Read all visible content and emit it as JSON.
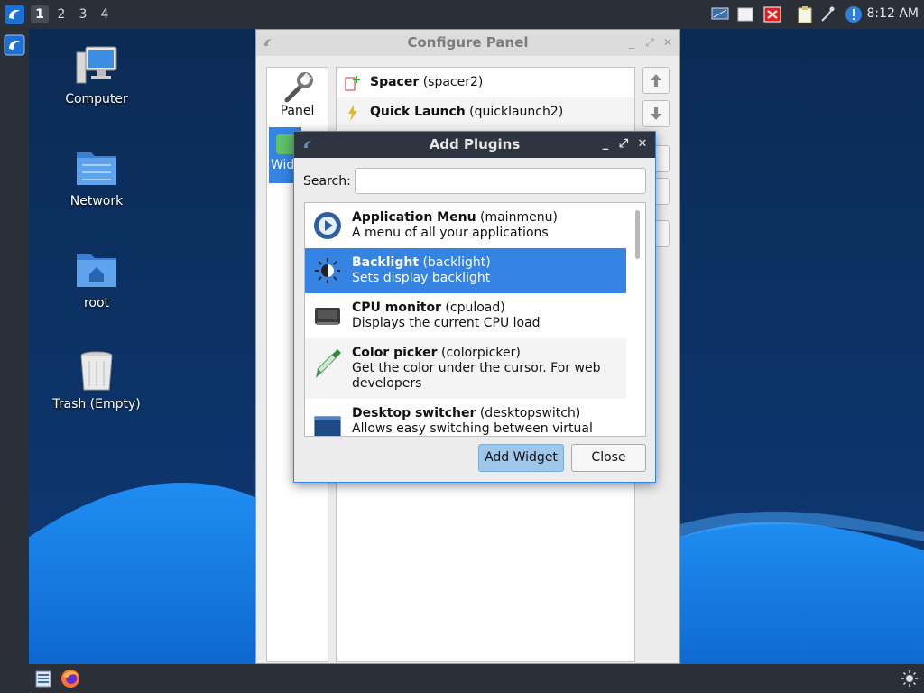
{
  "top_panel": {
    "workspaces": [
      "1",
      "2",
      "3",
      "4"
    ],
    "active_workspace": "1",
    "clock": "8:12 AM",
    "tray_icons": [
      "display-icon",
      "notes-icon",
      "close-app-icon",
      "clipboard-icon",
      "network-icon",
      "info-icon"
    ]
  },
  "desktop": {
    "icons": [
      {
        "label": "Computer",
        "icon": "computer-icon"
      },
      {
        "label": "Network",
        "icon": "network-folder-icon"
      },
      {
        "label": "root",
        "icon": "home-folder-icon"
      },
      {
        "label": "Trash (Empty)",
        "icon": "trash-icon"
      }
    ]
  },
  "configure_panel": {
    "title": "Configure Panel",
    "tabs": [
      {
        "label": "Panel",
        "icon": "wrench-icon"
      },
      {
        "label": "Wid",
        "icon": "widgets-icon"
      }
    ],
    "widgets": [
      {
        "name": "Spacer",
        "id": "(spacer2)"
      },
      {
        "name": "Quick Launch",
        "id": "(quicklaunch2)"
      }
    ]
  },
  "add_plugins": {
    "title": "Add Plugins",
    "search_label": "Search:",
    "search_value": "",
    "plugins": [
      {
        "name": "Application Menu",
        "id": "(mainmenu)",
        "desc": "A menu of all your applications"
      },
      {
        "name": "Backlight",
        "id": "(backlight)",
        "desc": "Sets display backlight"
      },
      {
        "name": "CPU monitor",
        "id": "(cpuload)",
        "desc": "Displays the current CPU load"
      },
      {
        "name": "Color picker",
        "id": "(colorpicker)",
        "desc": "Get the color under the cursor. For web developers"
      },
      {
        "name": "Desktop switcher",
        "id": "(desktopswitch)",
        "desc": "Allows easy switching between virtual"
      }
    ],
    "selected_plugin": "Backlight",
    "add_button": "Add Widget",
    "close_button": "Close"
  },
  "colors": {
    "accent": "#3584e4",
    "panel": "#2b3038",
    "titlebar": "#2f3540"
  }
}
